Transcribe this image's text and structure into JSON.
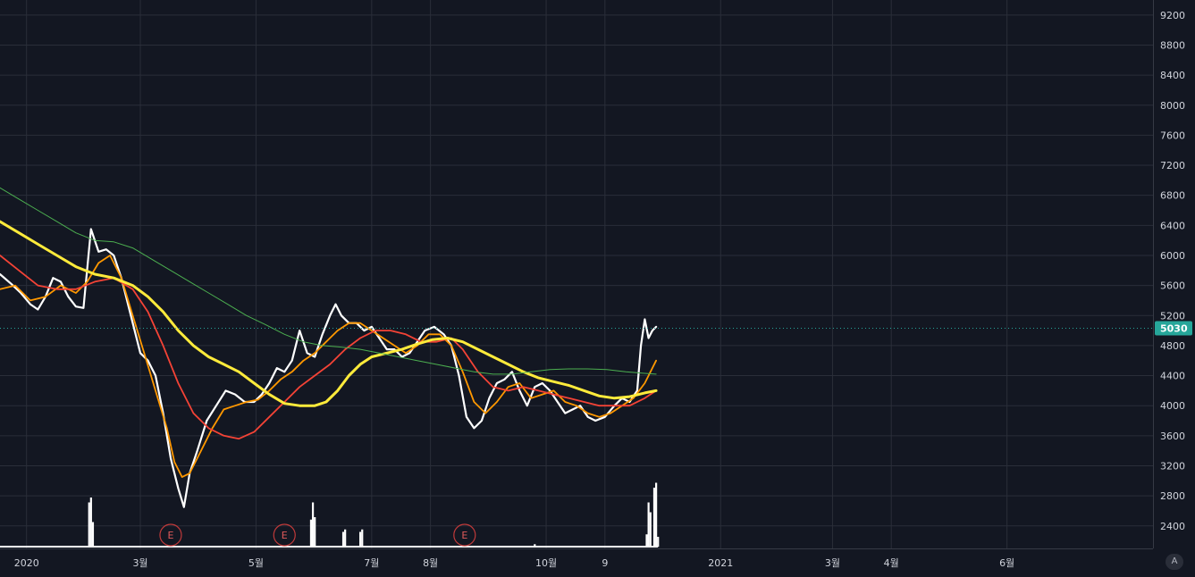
{
  "chart_data": {
    "type": "line",
    "x_axis": {
      "tick_labels": [
        "2020",
        "3월",
        "5월",
        "7월",
        "8월",
        "10월",
        "9",
        "2021",
        "3월",
        "4월",
        "6월"
      ],
      "tick_days": [
        0,
        60,
        121,
        182,
        213,
        274,
        305,
        366,
        425,
        456,
        517
      ],
      "range_days": [
        -14,
        594
      ]
    },
    "y_axis": {
      "ticks": [
        2400,
        2800,
        3200,
        3600,
        4000,
        4400,
        4800,
        5200,
        5600,
        6000,
        6400,
        6800,
        7200,
        7600,
        8000,
        8400,
        8800,
        9200
      ],
      "range": [
        2100,
        9400
      ],
      "position": "right"
    },
    "grid": true,
    "last_price": {
      "value": 5030,
      "label": "5030",
      "color": "#26a69a"
    },
    "colors": {
      "background": "#131722",
      "grid": "#2a2e39",
      "axis_text": "#d1d4dc",
      "candle_up": "#26a69a",
      "candle_down": "#ef5350",
      "volume": "#ffffff"
    },
    "series": [
      {
        "color": "#ffffff",
        "width": 2.2,
        "points": [
          [
            -14,
            5750
          ],
          [
            -8,
            5620
          ],
          [
            -3,
            5500
          ],
          [
            2,
            5350
          ],
          [
            6,
            5280
          ],
          [
            10,
            5450
          ],
          [
            14,
            5700
          ],
          [
            18,
            5650
          ],
          [
            22,
            5450
          ],
          [
            26,
            5320
          ],
          [
            30,
            5300
          ],
          [
            34,
            6350
          ],
          [
            38,
            6050
          ],
          [
            42,
            6080
          ],
          [
            46,
            6000
          ],
          [
            50,
            5700
          ],
          [
            55,
            5200
          ],
          [
            60,
            4700
          ],
          [
            64,
            4600
          ],
          [
            68,
            4400
          ],
          [
            72,
            3900
          ],
          [
            76,
            3300
          ],
          [
            80,
            2900
          ],
          [
            83,
            2650
          ],
          [
            86,
            3100
          ],
          [
            90,
            3400
          ],
          [
            95,
            3800
          ],
          [
            100,
            4000
          ],
          [
            105,
            4200
          ],
          [
            110,
            4150
          ],
          [
            115,
            4050
          ],
          [
            120,
            4050
          ],
          [
            124,
            4150
          ],
          [
            128,
            4300
          ],
          [
            132,
            4500
          ],
          [
            136,
            4450
          ],
          [
            140,
            4600
          ],
          [
            144,
            5000
          ],
          [
            148,
            4700
          ],
          [
            152,
            4650
          ],
          [
            156,
            4950
          ],
          [
            160,
            5200
          ],
          [
            163,
            5350
          ],
          [
            166,
            5200
          ],
          [
            170,
            5100
          ],
          [
            174,
            5100
          ],
          [
            178,
            5000
          ],
          [
            182,
            5050
          ],
          [
            186,
            4900
          ],
          [
            190,
            4750
          ],
          [
            194,
            4750
          ],
          [
            198,
            4650
          ],
          [
            202,
            4700
          ],
          [
            206,
            4850
          ],
          [
            210,
            5000
          ],
          [
            215,
            5050
          ],
          [
            220,
            4950
          ],
          [
            224,
            4800
          ],
          [
            228,
            4400
          ],
          [
            232,
            3850
          ],
          [
            236,
            3700
          ],
          [
            240,
            3800
          ],
          [
            244,
            4100
          ],
          [
            248,
            4300
          ],
          [
            252,
            4350
          ],
          [
            256,
            4450
          ],
          [
            260,
            4200
          ],
          [
            264,
            4000
          ],
          [
            268,
            4250
          ],
          [
            272,
            4300
          ],
          [
            276,
            4200
          ],
          [
            280,
            4050
          ],
          [
            284,
            3900
          ],
          [
            288,
            3950
          ],
          [
            292,
            4000
          ],
          [
            296,
            3850
          ],
          [
            300,
            3800
          ],
          [
            305,
            3850
          ],
          [
            310,
            4000
          ],
          [
            314,
            4100
          ],
          [
            318,
            4050
          ],
          [
            322,
            4200
          ],
          [
            324,
            4800
          ],
          [
            326,
            5150
          ],
          [
            328,
            4900
          ],
          [
            330,
            5000
          ],
          [
            332,
            5050
          ]
        ]
      },
      {
        "color": "#ff9800",
        "width": 1.8,
        "points": [
          [
            -14,
            5550
          ],
          [
            -6,
            5600
          ],
          [
            2,
            5400
          ],
          [
            10,
            5450
          ],
          [
            18,
            5600
          ],
          [
            26,
            5500
          ],
          [
            32,
            5650
          ],
          [
            38,
            5900
          ],
          [
            44,
            6000
          ],
          [
            50,
            5700
          ],
          [
            56,
            5200
          ],
          [
            62,
            4700
          ],
          [
            68,
            4200
          ],
          [
            74,
            3700
          ],
          [
            78,
            3250
          ],
          [
            82,
            3050
          ],
          [
            86,
            3100
          ],
          [
            92,
            3400
          ],
          [
            98,
            3700
          ],
          [
            104,
            3950
          ],
          [
            110,
            4000
          ],
          [
            116,
            4050
          ],
          [
            122,
            4080
          ],
          [
            128,
            4200
          ],
          [
            134,
            4350
          ],
          [
            140,
            4450
          ],
          [
            146,
            4600
          ],
          [
            152,
            4700
          ],
          [
            158,
            4850
          ],
          [
            164,
            5000
          ],
          [
            170,
            5100
          ],
          [
            176,
            5100
          ],
          [
            182,
            5000
          ],
          [
            188,
            4900
          ],
          [
            194,
            4800
          ],
          [
            200,
            4700
          ],
          [
            206,
            4800
          ],
          [
            212,
            4950
          ],
          [
            218,
            4950
          ],
          [
            224,
            4800
          ],
          [
            230,
            4450
          ],
          [
            236,
            4050
          ],
          [
            242,
            3900
          ],
          [
            248,
            4050
          ],
          [
            254,
            4250
          ],
          [
            260,
            4300
          ],
          [
            266,
            4100
          ],
          [
            272,
            4150
          ],
          [
            278,
            4200
          ],
          [
            284,
            4050
          ],
          [
            290,
            4000
          ],
          [
            296,
            3900
          ],
          [
            302,
            3850
          ],
          [
            308,
            3900
          ],
          [
            314,
            4000
          ],
          [
            320,
            4100
          ],
          [
            326,
            4300
          ],
          [
            332,
            4600
          ]
        ]
      },
      {
        "color": "#f44336",
        "width": 1.8,
        "points": [
          [
            -14,
            6000
          ],
          [
            -4,
            5800
          ],
          [
            6,
            5600
          ],
          [
            16,
            5550
          ],
          [
            26,
            5550
          ],
          [
            36,
            5650
          ],
          [
            46,
            5700
          ],
          [
            56,
            5550
          ],
          [
            64,
            5250
          ],
          [
            72,
            4800
          ],
          [
            80,
            4300
          ],
          [
            88,
            3900
          ],
          [
            96,
            3700
          ],
          [
            104,
            3600
          ],
          [
            112,
            3560
          ],
          [
            120,
            3650
          ],
          [
            128,
            3850
          ],
          [
            136,
            4050
          ],
          [
            144,
            4250
          ],
          [
            152,
            4400
          ],
          [
            160,
            4550
          ],
          [
            168,
            4750
          ],
          [
            176,
            4900
          ],
          [
            184,
            5000
          ],
          [
            192,
            5000
          ],
          [
            200,
            4950
          ],
          [
            208,
            4850
          ],
          [
            216,
            4850
          ],
          [
            224,
            4900
          ],
          [
            230,
            4750
          ],
          [
            238,
            4450
          ],
          [
            246,
            4250
          ],
          [
            254,
            4200
          ],
          [
            262,
            4250
          ],
          [
            270,
            4200
          ],
          [
            278,
            4150
          ],
          [
            286,
            4100
          ],
          [
            294,
            4050
          ],
          [
            302,
            4000
          ],
          [
            310,
            4000
          ],
          [
            318,
            4000
          ],
          [
            326,
            4100
          ],
          [
            332,
            4200
          ]
        ]
      },
      {
        "color": "#ffeb3b",
        "width": 3,
        "points": [
          [
            -14,
            6450
          ],
          [
            -4,
            6300
          ],
          [
            6,
            6150
          ],
          [
            16,
            6000
          ],
          [
            26,
            5850
          ],
          [
            36,
            5750
          ],
          [
            46,
            5700
          ],
          [
            56,
            5600
          ],
          [
            64,
            5450
          ],
          [
            72,
            5250
          ],
          [
            80,
            5000
          ],
          [
            88,
            4800
          ],
          [
            96,
            4650
          ],
          [
            104,
            4550
          ],
          [
            112,
            4450
          ],
          [
            120,
            4300
          ],
          [
            128,
            4150
          ],
          [
            136,
            4030
          ],
          [
            144,
            4000
          ],
          [
            152,
            4000
          ],
          [
            158,
            4050
          ],
          [
            164,
            4200
          ],
          [
            170,
            4400
          ],
          [
            176,
            4550
          ],
          [
            182,
            4650
          ],
          [
            190,
            4700
          ],
          [
            198,
            4750
          ],
          [
            206,
            4820
          ],
          [
            214,
            4880
          ],
          [
            222,
            4900
          ],
          [
            230,
            4850
          ],
          [
            238,
            4750
          ],
          [
            246,
            4650
          ],
          [
            254,
            4550
          ],
          [
            262,
            4450
          ],
          [
            270,
            4370
          ],
          [
            278,
            4320
          ],
          [
            286,
            4270
          ],
          [
            294,
            4200
          ],
          [
            302,
            4130
          ],
          [
            310,
            4100
          ],
          [
            318,
            4120
          ],
          [
            326,
            4170
          ],
          [
            332,
            4200
          ]
        ]
      },
      {
        "color": "#4caf50",
        "width": 1,
        "points": [
          [
            -14,
            6900
          ],
          [
            -4,
            6750
          ],
          [
            6,
            6600
          ],
          [
            16,
            6450
          ],
          [
            26,
            6300
          ],
          [
            36,
            6200
          ],
          [
            46,
            6180
          ],
          [
            56,
            6100
          ],
          [
            66,
            5950
          ],
          [
            76,
            5800
          ],
          [
            86,
            5650
          ],
          [
            96,
            5500
          ],
          [
            106,
            5350
          ],
          [
            116,
            5200
          ],
          [
            126,
            5080
          ],
          [
            136,
            4950
          ],
          [
            146,
            4850
          ],
          [
            156,
            4800
          ],
          [
            166,
            4780
          ],
          [
            176,
            4750
          ],
          [
            186,
            4700
          ],
          [
            196,
            4650
          ],
          [
            206,
            4600
          ],
          [
            216,
            4550
          ],
          [
            226,
            4500
          ],
          [
            236,
            4450
          ],
          [
            246,
            4420
          ],
          [
            256,
            4420
          ],
          [
            266,
            4450
          ],
          [
            276,
            4480
          ],
          [
            286,
            4490
          ],
          [
            296,
            4490
          ],
          [
            306,
            4480
          ],
          [
            316,
            4450
          ],
          [
            326,
            4430
          ],
          [
            332,
            4420
          ]
        ]
      }
    ],
    "earnings_markers": [
      {
        "day": 76,
        "label": "E"
      },
      {
        "day": 136,
        "label": "E"
      },
      {
        "day": 231,
        "label": "E"
      }
    ],
    "volume_spikes": [
      [
        33,
        0.9
      ],
      [
        34,
        1.0
      ],
      [
        35,
        0.5
      ],
      [
        150,
        0.55
      ],
      [
        151,
        0.9
      ],
      [
        152,
        0.6
      ],
      [
        167,
        0.3
      ],
      [
        168,
        0.35
      ],
      [
        176,
        0.3
      ],
      [
        177,
        0.35
      ],
      [
        268,
        0.05
      ],
      [
        327,
        0.25
      ],
      [
        328,
        0.9
      ],
      [
        329,
        0.7
      ],
      [
        331,
        1.2
      ],
      [
        332,
        1.3
      ],
      [
        333,
        0.2
      ]
    ]
  }
}
